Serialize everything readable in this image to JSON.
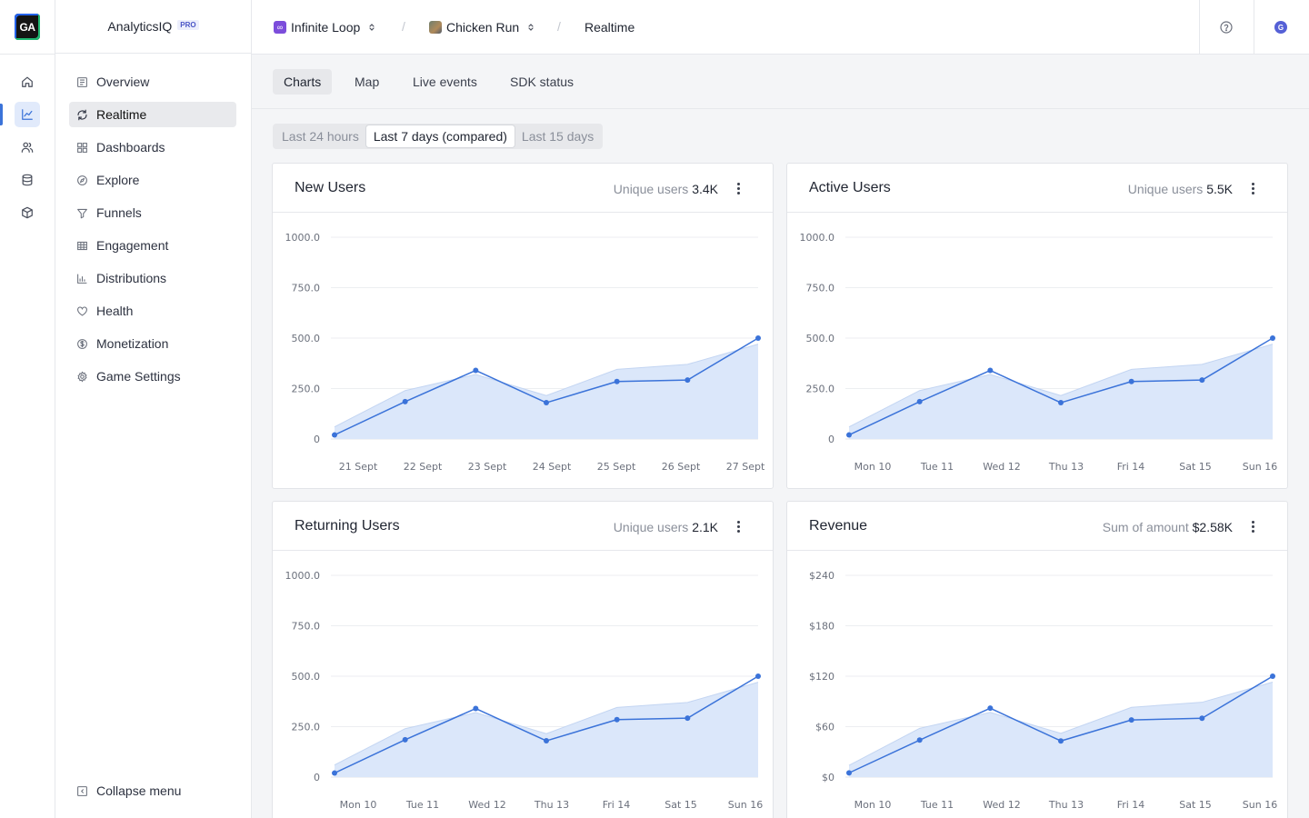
{
  "app": {
    "logo_text": "GA",
    "brand_name": "AnalyticsIQ",
    "brand_badge": "PRO"
  },
  "rail": {
    "items": [
      {
        "icon": "home-icon"
      },
      {
        "icon": "chart-line-icon",
        "active": true
      },
      {
        "icon": "users-icon"
      },
      {
        "icon": "database-icon"
      },
      {
        "icon": "cube-icon"
      }
    ]
  },
  "sidebar": {
    "items": [
      {
        "label": "Overview",
        "icon": "overview-icon"
      },
      {
        "label": "Realtime",
        "icon": "refresh-icon",
        "active": true
      },
      {
        "label": "Dashboards",
        "icon": "grid-icon"
      },
      {
        "label": "Explore",
        "icon": "compass-icon"
      },
      {
        "label": "Funnels",
        "icon": "funnel-icon"
      },
      {
        "label": "Engagement",
        "icon": "table-icon"
      },
      {
        "label": "Distributions",
        "icon": "bar-chart-icon"
      },
      {
        "label": "Health",
        "icon": "heart-icon"
      },
      {
        "label": "Monetization",
        "icon": "dollar-icon"
      },
      {
        "label": "Game Settings",
        "icon": "gear-icon"
      }
    ],
    "collapse_label": "Collapse menu"
  },
  "breadcrumb": {
    "org": "Infinite Loop",
    "game": "Chicken Run",
    "page": "Realtime"
  },
  "header": {
    "avatar_initial": "G"
  },
  "tabs": [
    "Charts",
    "Map",
    "Live events",
    "SDK status"
  ],
  "active_tab": "Charts",
  "range": {
    "options": [
      "Last 24 hours",
      "Last 7 days (compared)",
      "Last 15 days"
    ],
    "selected": "Last 7 days (compared)"
  },
  "colors": {
    "accent": "#3b73d9",
    "area_fill": "#dbe7fa",
    "area_stroke": "#c3d5f2"
  },
  "cards": [
    {
      "title": "New Users",
      "metric_label": "Unique users",
      "metric_value": "3.4K",
      "chart_data": {
        "type": "area",
        "categories": [
          "21 Sept",
          "22 Sept",
          "23 Sept",
          "24 Sept",
          "25 Sept",
          "26 Sept",
          "27 Sept"
        ],
        "yticks": [
          "0",
          "250.0",
          "500.0",
          "750.0",
          "1000.0"
        ],
        "ylim": [
          0,
          1000
        ],
        "grid": true,
        "series": [
          {
            "values": [
              20,
              185,
              340,
              180,
              285,
              292,
              500
            ]
          },
          {
            "values": [
              60,
              240,
              320,
              215,
              345,
              370,
              470
            ]
          }
        ]
      }
    },
    {
      "title": "Active Users",
      "metric_label": "Unique users",
      "metric_value": "5.5K",
      "chart_data": {
        "type": "area",
        "categories": [
          "Mon 10",
          "Tue 11",
          "Wed 12",
          "Thu 13",
          "Fri 14",
          "Sat 15",
          "Sun 16"
        ],
        "yticks": [
          "0",
          "250.0",
          "500.0",
          "750.0",
          "1000.0"
        ],
        "ylim": [
          0,
          1000
        ],
        "grid": true,
        "series": [
          {
            "values": [
              20,
              185,
              340,
              180,
              285,
              292,
              500
            ]
          },
          {
            "values": [
              60,
              240,
              320,
              215,
              345,
              370,
              470
            ]
          }
        ]
      }
    },
    {
      "title": "Returning Users",
      "metric_label": "Unique users",
      "metric_value": "2.1K",
      "chart_data": {
        "type": "area",
        "categories": [
          "Mon 10",
          "Tue 11",
          "Wed 12",
          "Thu 13",
          "Fri 14",
          "Sat 15",
          "Sun 16"
        ],
        "yticks": [
          "0",
          "250.0",
          "500.0",
          "750.0",
          "1000.0"
        ],
        "ylim": [
          0,
          1000
        ],
        "grid": true,
        "series": [
          {
            "values": [
              20,
              185,
              340,
              180,
              285,
              292,
              500
            ]
          },
          {
            "values": [
              60,
              240,
              320,
              215,
              345,
              370,
              470
            ]
          }
        ]
      }
    },
    {
      "title": "Revenue",
      "metric_label": "Sum of amount",
      "metric_value": "$2.58K",
      "chart_data": {
        "type": "area",
        "categories": [
          "Mon 10",
          "Tue 11",
          "Wed 12",
          "Thu 13",
          "Fri 14",
          "Sat 15",
          "Sun 16"
        ],
        "yticks": [
          "$0",
          "$60",
          "$120",
          "$180",
          "$240"
        ],
        "ylim": [
          0,
          240
        ],
        "grid": true,
        "series": [
          {
            "values": [
              5,
              44,
              82,
              43,
              68,
              70,
              120
            ]
          },
          {
            "values": [
              14,
              58,
              77,
              52,
              83,
              89,
              113
            ]
          }
        ]
      }
    }
  ]
}
